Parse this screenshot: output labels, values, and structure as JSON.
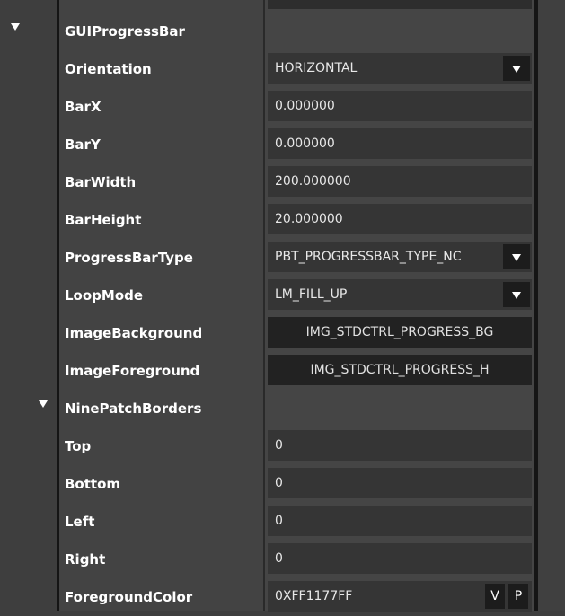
{
  "section": {
    "title": "GUIProgressBar"
  },
  "properties": {
    "orientation": {
      "label": "Orientation",
      "value": "HORIZONTAL"
    },
    "bar_x": {
      "label": "BarX",
      "value": "0.000000"
    },
    "bar_y": {
      "label": "BarY",
      "value": "0.000000"
    },
    "bar_width": {
      "label": "BarWidth",
      "value": "200.000000"
    },
    "bar_height": {
      "label": "BarHeight",
      "value": "20.000000"
    },
    "progress_bar_type": {
      "label": "ProgressBarType",
      "value": "PBT_PROGRESSBAR_TYPE_NC"
    },
    "loop_mode": {
      "label": "LoopMode",
      "value": "LM_FILL_UP"
    },
    "image_background": {
      "label": "ImageBackground",
      "value": "IMG_STDCTRL_PROGRESS_BG"
    },
    "image_foreground": {
      "label": "ImageForeground",
      "value": "IMG_STDCTRL_PROGRESS_H"
    }
  },
  "nine_patch": {
    "title": "NinePatchBorders",
    "top": {
      "label": "Top",
      "value": "0"
    },
    "bottom": {
      "label": "Bottom",
      "value": "0"
    },
    "left": {
      "label": "Left",
      "value": "0"
    },
    "right": {
      "label": "Right",
      "value": "0"
    }
  },
  "foreground_color": {
    "label": "ForegroundColor",
    "value": "0XFF1177FF",
    "v_label": "V",
    "p_label": "P"
  },
  "icons": {
    "expand": "chevron-down-icon",
    "dropdown": "dropdown-arrow-icon"
  }
}
